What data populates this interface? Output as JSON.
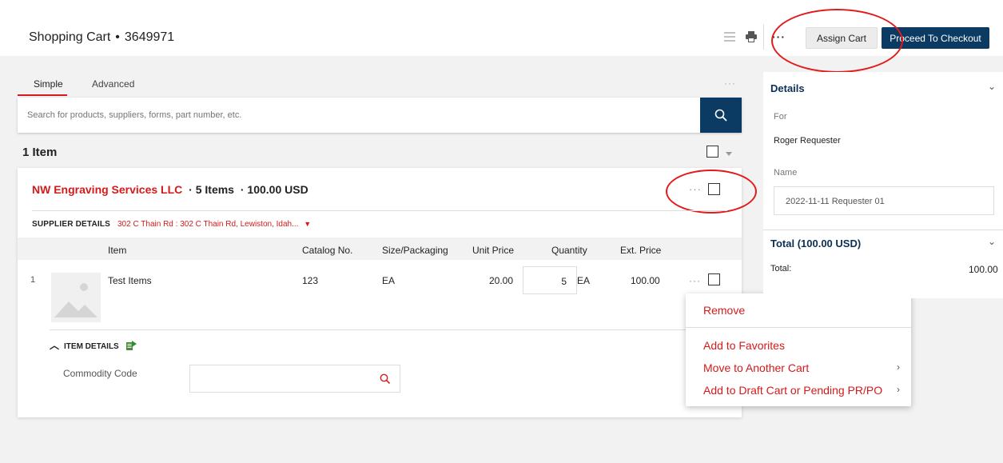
{
  "header": {
    "title": "Shopping Cart",
    "separator": "•",
    "cart_number": "3649971",
    "more": "···",
    "assign_cart": "Assign Cart",
    "proceed_checkout": "Proceed To Checkout"
  },
  "tabs": [
    {
      "label": "Simple",
      "active": true
    },
    {
      "label": "Advanced",
      "active": false
    }
  ],
  "tabs_more": "···",
  "search": {
    "placeholder": "Search for products, suppliers, forms, part number, etc."
  },
  "item_count": "1 Item",
  "supplier": {
    "name": "NW Engraving Services LLC",
    "items": "· 5 Items",
    "total": "· 100.00 USD",
    "more": "···",
    "details_label": "SUPPLIER DETAILS",
    "address": "302 C Thain Rd : 302 C Thain Rd, Lewiston, Idah..."
  },
  "table": {
    "headers": {
      "item": "Item",
      "catalog": "Catalog No.",
      "size": "Size/Packaging",
      "unit_price": "Unit Price",
      "quantity": "Quantity",
      "ext_price": "Ext. Price"
    },
    "rows": [
      {
        "num": "1",
        "name": "Test Items",
        "catalog": "123",
        "size": "EA",
        "unit_price": "20.00",
        "qty": "5",
        "unit": "EA",
        "ext_price": "100.00",
        "more": "···"
      }
    ]
  },
  "item_details": {
    "label": "ITEM DETAILS",
    "commodity_label": "Commodity Code"
  },
  "context_menu": {
    "remove": "Remove",
    "favorites": "Add to Favorites",
    "move": "Move to Another Cart",
    "draft": "Add to Draft Cart or Pending PR/PO"
  },
  "details_panel": {
    "title": "Details",
    "for_label": "For",
    "for_value": "Roger Requester",
    "name_label": "Name",
    "name_value": "2022-11-11 Requester 01",
    "total_title": "Total (100.00 USD)",
    "total_label": "Total:",
    "total_value": "100.00"
  },
  "colors": {
    "brand_navy": "#0b3a63",
    "accent_red": "#d41a1a",
    "annotation_red": "#e31a1a"
  }
}
